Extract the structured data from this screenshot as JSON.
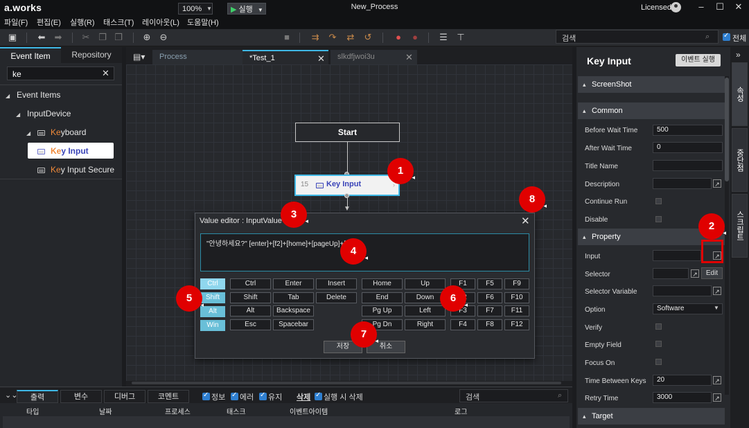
{
  "app": {
    "logo": "a.works",
    "window_title": "New_Process",
    "license": "Licensed"
  },
  "menu": [
    "파일(F)",
    "편집(E)",
    "실행(R)",
    "태스크(T)",
    "레이아웃(L)",
    "도움말(H)"
  ],
  "toolbar": {
    "zoom": "100%",
    "run_label": "실행",
    "search_placeholder": "검색",
    "check_all_label": "전체"
  },
  "left_panel": {
    "tabs": [
      "Event Item",
      "Repository"
    ],
    "search_value": "ke",
    "tree": {
      "event_items": "Event Items",
      "input_device": "InputDevice",
      "keyboard_hl": "Ke",
      "keyboard_rest": "yboard",
      "key_input_hl": "Ke",
      "key_input_rest": "y Input",
      "key_input_secure_hl": "Ke",
      "key_input_secure_rest": "y Input Secure"
    }
  },
  "doc_tabs": [
    "Process",
    "*Test_1",
    "slkdfjwoi3u"
  ],
  "flow": {
    "start_label": "Start",
    "node_number": "15",
    "node_label": "Key Input"
  },
  "callouts": [
    "1",
    "2",
    "3",
    "4",
    "5",
    "6",
    "7",
    "8"
  ],
  "dialog": {
    "title": "Value editor : InputValue",
    "value": "\"안녕하세요?\" [enter]+[f2]+[home]+[pageUp]+[f5]]",
    "modifiers": [
      "Ctrl",
      "Shift",
      "Alt",
      "Win"
    ],
    "keys_col1": [
      "Ctrl",
      "Shift",
      "Alt",
      "Esc"
    ],
    "keys_col2": [
      "Enter",
      "Tab",
      "Backspace",
      "Spacebar"
    ],
    "keys_col3": [
      "Insert",
      "Delete"
    ],
    "keys_col4": [
      "Home",
      "End",
      "Pg Up",
      "Pg Dn"
    ],
    "keys_col5": [
      "Up",
      "Down",
      "Left",
      "Right"
    ],
    "keys_col6": [
      "F1",
      "F2",
      "F3",
      "F4"
    ],
    "keys_col7": [
      "F5",
      "F6",
      "F7",
      "F8"
    ],
    "keys_col8": [
      "F9",
      "F10",
      "F11",
      "F12"
    ],
    "save_label": "저장",
    "cancel_label": "취소"
  },
  "bottom_panel": {
    "tabs": [
      "출력",
      "변수",
      "디버그",
      "코멘트"
    ],
    "filters": [
      "정보",
      "에러",
      "유지"
    ],
    "clear_label": "삭제",
    "clear_on_run_label": "실행 시 삭제",
    "search_placeholder": "검색",
    "columns": [
      "타입",
      "날짜",
      "프로세스",
      "태스크",
      "이벤트아이템",
      "로그"
    ]
  },
  "properties": {
    "title": "Key Input",
    "run_event_label": "이벤트 실행",
    "sections": {
      "screenshot": "ScreenShot",
      "common": "Common",
      "property": "Property",
      "target": "Target"
    },
    "labels": {
      "before_wait": "Before Wait Time",
      "after_wait": "After Wait Time",
      "title_name": "Title Name",
      "description": "Description",
      "continue_run": "Continue Run",
      "disable": "Disable",
      "input": "Input",
      "selector": "Selector",
      "selector_variable": "Selector Variable",
      "option": "Option",
      "verify": "Verify",
      "empty_field": "Empty Field",
      "focus_on": "Focus On",
      "time_between_keys": "Time Between Keys",
      "retry_time": "Retry Time"
    },
    "values": {
      "before_wait": "500",
      "after_wait": "0",
      "option": "Software",
      "time_between_keys": "20",
      "retry_time": "3000",
      "edit_label": "Edit"
    },
    "side_tabs": [
      "속성",
      "중단점",
      "스크립트"
    ]
  }
}
